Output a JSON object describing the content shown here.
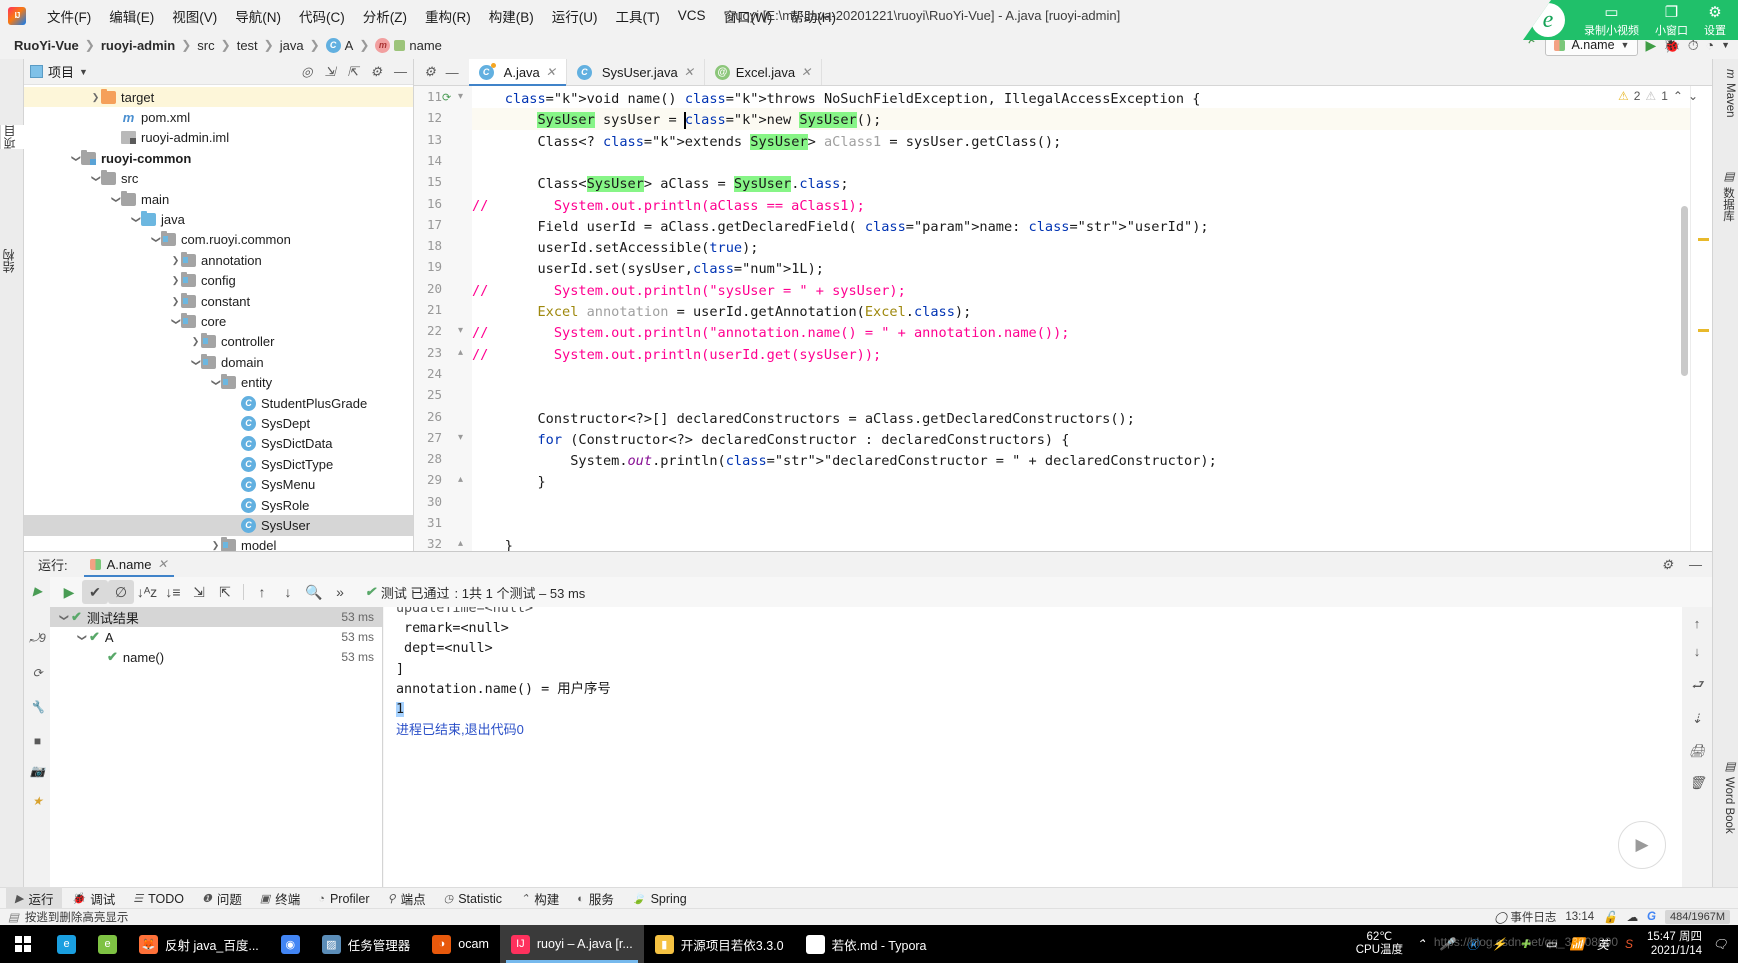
{
  "window": {
    "title": "ruoyi [E:\\my-Java-20201221\\ruoyi\\RuoYi-Vue] - A.java [ruoyi-admin]"
  },
  "menubar": {
    "items": [
      {
        "label": "文件(F)"
      },
      {
        "label": "编辑(E)"
      },
      {
        "label": "视图(V)"
      },
      {
        "label": "导航(N)"
      },
      {
        "label": "代码(C)"
      },
      {
        "label": "分析(Z)"
      },
      {
        "label": "重构(R)"
      },
      {
        "label": "构建(B)"
      },
      {
        "label": "运行(U)"
      },
      {
        "label": "工具(T)"
      },
      {
        "label": "VCS"
      },
      {
        "label": "窗口(W)"
      },
      {
        "label": "帮助(H)"
      }
    ]
  },
  "breadcrumb": {
    "items": [
      {
        "label": "RuoYi-Vue"
      },
      {
        "label": "ruoyi-admin"
      },
      {
        "label": "src"
      },
      {
        "label": "test"
      },
      {
        "label": "java"
      },
      {
        "label": "A"
      },
      {
        "label": "name"
      }
    ]
  },
  "toolbar": {
    "run_config": "A.name",
    "hammer_title": "构建",
    "run_title": "运行",
    "debug_title": "调试"
  },
  "recording": {
    "label": "录制小视频",
    "window_btn": "小窗口",
    "settings_btn": "设置"
  },
  "project": {
    "title": "项目",
    "tree": [
      {
        "label": "target",
        "type": "folder-orange",
        "indent": 3,
        "arrow": "right",
        "sel": "yellow"
      },
      {
        "label": "pom.xml",
        "type": "maven",
        "indent": 4,
        "arrow": "none"
      },
      {
        "label": "ruoyi-admin.iml",
        "type": "iml",
        "indent": 4,
        "arrow": "none"
      },
      {
        "label": "ruoyi-common",
        "type": "module",
        "indent": 2,
        "arrow": "down",
        "bold": true
      },
      {
        "label": "src",
        "type": "folder",
        "indent": 3,
        "arrow": "down"
      },
      {
        "label": "main",
        "type": "folder",
        "indent": 4,
        "arrow": "down"
      },
      {
        "label": "java",
        "type": "folder-blue",
        "indent": 5,
        "arrow": "down"
      },
      {
        "label": "com.ruoyi.common",
        "type": "package",
        "indent": 6,
        "arrow": "down"
      },
      {
        "label": "annotation",
        "type": "package",
        "indent": 7,
        "arrow": "right"
      },
      {
        "label": "config",
        "type": "package",
        "indent": 7,
        "arrow": "right"
      },
      {
        "label": "constant",
        "type": "package",
        "indent": 7,
        "arrow": "right"
      },
      {
        "label": "core",
        "type": "package",
        "indent": 7,
        "arrow": "down"
      },
      {
        "label": "controller",
        "type": "package",
        "indent": 8,
        "arrow": "right"
      },
      {
        "label": "domain",
        "type": "package",
        "indent": 8,
        "arrow": "down"
      },
      {
        "label": "entity",
        "type": "package",
        "indent": 9,
        "arrow": "down"
      },
      {
        "label": "StudentPlusGrade",
        "type": "class",
        "indent": 10,
        "arrow": "none"
      },
      {
        "label": "SysDept",
        "type": "class",
        "indent": 10,
        "arrow": "none"
      },
      {
        "label": "SysDictData",
        "type": "class",
        "indent": 10,
        "arrow": "none"
      },
      {
        "label": "SysDictType",
        "type": "class",
        "indent": 10,
        "arrow": "none"
      },
      {
        "label": "SysMenu",
        "type": "class",
        "indent": 10,
        "arrow": "none"
      },
      {
        "label": "SysRole",
        "type": "class",
        "indent": 10,
        "arrow": "none"
      },
      {
        "label": "SysUser",
        "type": "class",
        "indent": 10,
        "arrow": "none",
        "sel": "grey"
      },
      {
        "label": "model",
        "type": "package",
        "indent": 9,
        "arrow": "right"
      }
    ]
  },
  "editor": {
    "tabs": [
      {
        "label": "A.java",
        "icon": "class-modified-icon",
        "active": true
      },
      {
        "label": "SysUser.java",
        "icon": "class-icon",
        "active": false
      },
      {
        "label": "Excel.java",
        "icon": "annotation-icon",
        "active": false
      }
    ],
    "inspections": {
      "warnings": "2",
      "weak_warnings": "1"
    },
    "first_line_number": 11,
    "lines": [
      {
        "n": 11,
        "text": "    void name() throws NoSuchFieldException, IllegalAccessException {"
      },
      {
        "n": 12,
        "text": "        SysUser sysUser = new SysUser();"
      },
      {
        "n": 13,
        "text": "        Class<? extends SysUser> aClass1 = sysUser.getClass();"
      },
      {
        "n": 14,
        "text": ""
      },
      {
        "n": 15,
        "text": "        Class<SysUser> aClass = SysUser.class;"
      },
      {
        "n": 16,
        "text": "//        System.out.println(aClass == aClass1);"
      },
      {
        "n": 17,
        "text": "        Field userId = aClass.getDeclaredField( name: \"userId\");"
      },
      {
        "n": 18,
        "text": "        userId.setAccessible(true);"
      },
      {
        "n": 19,
        "text": "        userId.set(sysUser,1L);"
      },
      {
        "n": 20,
        "text": "//        System.out.println(\"sysUser = \" + sysUser);"
      },
      {
        "n": 21,
        "text": "        Excel annotation = userId.getAnnotation(Excel.class);"
      },
      {
        "n": 22,
        "text": "//        System.out.println(\"annotation.name() = \" + annotation.name());"
      },
      {
        "n": 23,
        "text": "//        System.out.println(userId.get(sysUser));"
      },
      {
        "n": 24,
        "text": ""
      },
      {
        "n": 25,
        "text": ""
      },
      {
        "n": 26,
        "text": "        Constructor<?>[] declaredConstructors = aClass.getDeclaredConstructors();"
      },
      {
        "n": 27,
        "text": "        for (Constructor<?> declaredConstructor : declaredConstructors) {"
      },
      {
        "n": 28,
        "text": "            System.out.println(\"declaredConstructor = \" + declaredConstructor);"
      },
      {
        "n": 29,
        "text": "        }"
      },
      {
        "n": 30,
        "text": ""
      },
      {
        "n": 31,
        "text": ""
      },
      {
        "n": 32,
        "text": "    }"
      }
    ]
  },
  "right_strip": {
    "items": [
      {
        "label": "Maven",
        "icon": "maven-icon"
      },
      {
        "label": "数据库",
        "icon": "database-icon"
      },
      {
        "label": "Word Book",
        "icon": "book-icon"
      }
    ]
  },
  "left_strip": {
    "items": [
      {
        "label": "项目",
        "icon": "project-icon"
      },
      {
        "label": "结构",
        "icon": "structure-icon"
      }
    ]
  },
  "run_panel": {
    "label": "运行:",
    "tab": "A.name",
    "status": {
      "prefix": "测试 已通过",
      "text": ": 1共 1 个测试 – 53 ms"
    },
    "tests": [
      {
        "label": "测试结果",
        "time": "53 ms",
        "indent": 0,
        "arrow": "down",
        "sel": true
      },
      {
        "label": "A",
        "time": "53 ms",
        "indent": 1,
        "arrow": "down",
        "sel": false
      },
      {
        "label": "name()",
        "time": "53 ms",
        "indent": 2,
        "arrow": "none",
        "sel": false
      }
    ],
    "console": [
      {
        "text": "updateTime=<null>",
        "type": "plain",
        "clipped": true
      },
      {
        "text": " remark=<null>",
        "type": "plain"
      },
      {
        "text": " dept=<null>",
        "type": "plain"
      },
      {
        "text": "]",
        "type": "plain"
      },
      {
        "text": "annotation.name() = 用户序号",
        "type": "plain"
      },
      {
        "text": "1",
        "type": "selected"
      },
      {
        "text": "",
        "type": "plain"
      },
      {
        "text": "进程已结束,退出代码0",
        "type": "link"
      }
    ]
  },
  "bottom_tabs": [
    {
      "label": "运行",
      "icon": "play-icon",
      "active": true
    },
    {
      "label": "调试",
      "icon": "bug-icon",
      "active": false
    },
    {
      "label": "TODO",
      "icon": "list-icon",
      "active": false
    },
    {
      "label": "问题",
      "icon": "warning-icon",
      "active": false
    },
    {
      "label": "终端",
      "icon": "terminal-icon",
      "active": false
    },
    {
      "label": "Profiler",
      "icon": "profiler-icon",
      "active": false
    },
    {
      "label": "端点",
      "icon": "endpoints-icon",
      "active": false
    },
    {
      "label": "Statistic",
      "icon": "statistic-icon",
      "active": false
    },
    {
      "label": "构建",
      "icon": "hammer-icon",
      "active": false
    },
    {
      "label": "服务",
      "icon": "services-icon",
      "active": false
    },
    {
      "label": "Spring",
      "icon": "spring-icon",
      "active": false
    }
  ],
  "statusbar": {
    "message": "按逃到删除高亮显示",
    "event_log": "事件日志",
    "time": "13:14",
    "memory": "484/1967M"
  },
  "taskbar": {
    "items": [
      {
        "label": "",
        "icon": "edge-icon",
        "color": "#1a9fe0"
      },
      {
        "label": "",
        "icon": "ie-icon",
        "color": "#7ec243"
      },
      {
        "label": "反射 java_百度...",
        "icon": "firefox-icon",
        "color": "#ff7139"
      },
      {
        "label": "",
        "icon": "chrome-icon",
        "color": "#4285f4"
      },
      {
        "label": "任务管理器",
        "icon": "taskmgr-icon",
        "color": "#5b8db8"
      },
      {
        "label": "ocam",
        "icon": "ocam-icon",
        "color": "#e8590c"
      },
      {
        "label": "ruoyi – A.java [r...",
        "icon": "intellij-icon",
        "color": "#fe315d",
        "active": true,
        "running": true
      },
      {
        "label": "开源项目若依3.3.0",
        "icon": "folder-icon",
        "color": "#f5c242"
      },
      {
        "label": "若依.md - Typora",
        "icon": "typora-icon",
        "color": "#ffffff"
      }
    ],
    "cpu_temp": "62℃",
    "cpu_label": "CPU温度",
    "clock_time": "15:47 周四",
    "clock_date": "2021/1/14",
    "watermark": "https://blog.csdn.net/qq_33608000"
  }
}
